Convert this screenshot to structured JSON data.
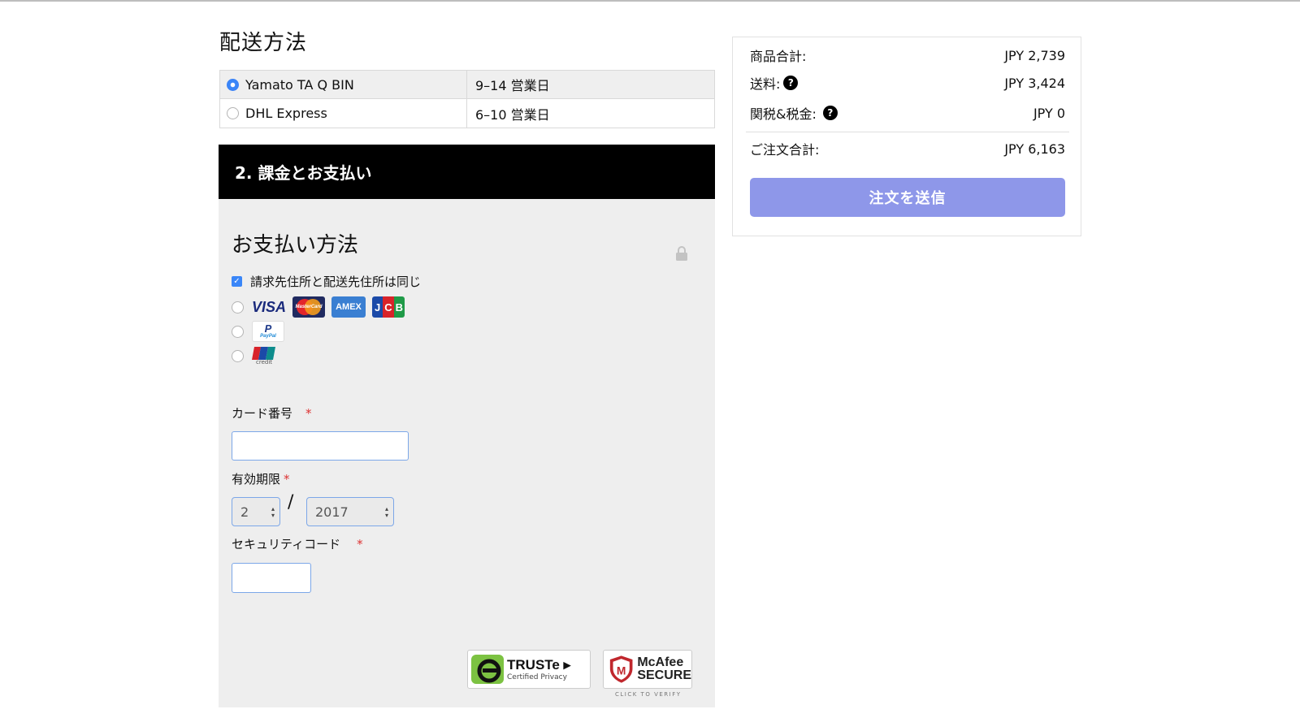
{
  "shipping": {
    "title": "配送方法",
    "options": [
      {
        "name": "Yamato TA Q BIN",
        "days": "9–14 営業日",
        "selected": true
      },
      {
        "name": "DHL Express",
        "days": "6–10 営業日",
        "selected": false
      }
    ]
  },
  "billing": {
    "section_title": "2. 課金とお支払い",
    "payment_title": "お支払い方法",
    "same_address_label": "請求先住所と配送先住所は同じ",
    "same_address_checked": true,
    "methods": {
      "cards": [
        "VISA",
        "MasterCard",
        "AMEX",
        "JCB"
      ],
      "paypal": "PayPal",
      "unionpay": "credit"
    },
    "card_number": {
      "label": "カード番号",
      "required_mark": "*",
      "value": ""
    },
    "expiry": {
      "label": "有効期限",
      "required_mark": "*",
      "month": "2",
      "separator": "/",
      "year": "2017"
    },
    "security_code": {
      "label": "セキュリティコード",
      "required_mark": "*",
      "value": ""
    },
    "badges": {
      "truste_name": "TRUSTe",
      "truste_sub": "Certified Privacy",
      "mcafee_name_1": "McAfee",
      "mcafee_name_2": "SECURE",
      "mcafee_verify": "CLICK TO VERIFY"
    }
  },
  "summary": {
    "subtotal_label": "商品合計:",
    "subtotal_value": "JPY 2,739",
    "shipping_label": "送料:",
    "shipping_value": "JPY 3,424",
    "tax_label": "関税&税金:",
    "tax_value": "JPY 0",
    "total_label": "ご注文合計:",
    "total_value": "JPY 6,163",
    "help_glyph": "?",
    "submit_label": "注文を送信",
    "submit_color": "#8e97e9"
  }
}
